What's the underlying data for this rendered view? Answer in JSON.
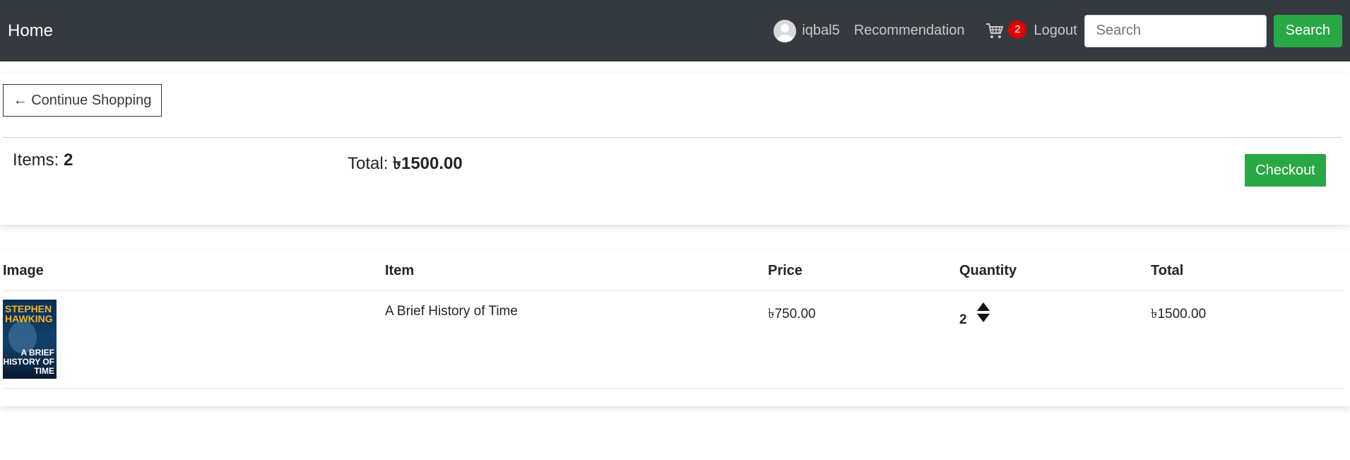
{
  "navbar": {
    "brand": "Home",
    "username": "iqbal5",
    "recommendation": "Recommendation",
    "cart_count": "2",
    "logout": "Logout",
    "search_placeholder": "Search",
    "search_button": "Search"
  },
  "summary": {
    "continue_label": "← Continue Shopping",
    "items_label": "Items: ",
    "items_count": "2",
    "total_label": "Total: ",
    "total_value": "৳1500.00",
    "checkout_label": "Checkout"
  },
  "table": {
    "headers": [
      "Image",
      "Item",
      "Price",
      "Quantity",
      "Total"
    ],
    "rows": [
      {
        "cover_author": "STEPHEN HAWKING",
        "cover_title": "A BRIEF HISTORY OF TIME",
        "item": "A Brief History of Time",
        "price": "৳750.00",
        "quantity": "2",
        "total": "৳1500.00"
      }
    ]
  },
  "colors": {
    "navbar_bg": "#343a40",
    "accent_green": "#28a745",
    "badge_red": "#e00000"
  }
}
